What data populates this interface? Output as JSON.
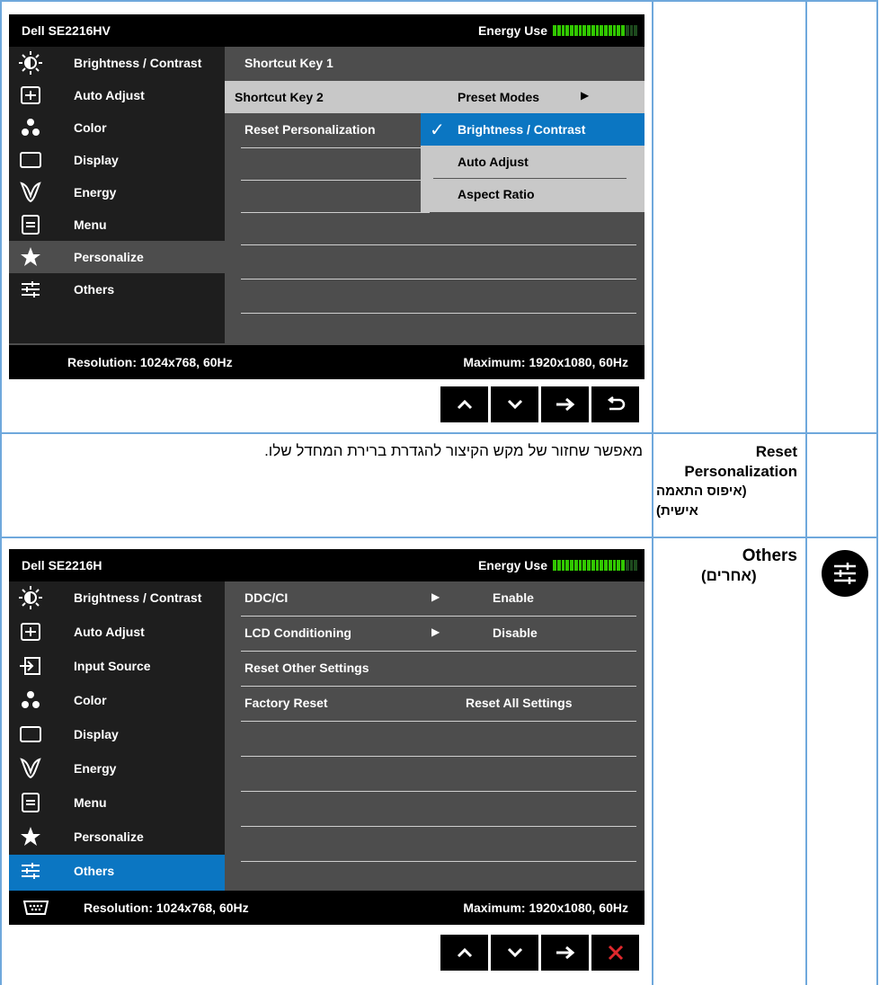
{
  "osd1": {
    "title": "Dell SE2216HV",
    "energy_label": "Energy Use",
    "energy_level": 0.85,
    "menu": [
      {
        "label": "Brightness / Contrast",
        "icon": "brightness-icon"
      },
      {
        "label": "Auto Adjust",
        "icon": "auto-adjust-icon"
      },
      {
        "label": "Color",
        "icon": "color-icon"
      },
      {
        "label": "Display",
        "icon": "display-icon"
      },
      {
        "label": "Energy",
        "icon": "energy-icon"
      },
      {
        "label": "Menu",
        "icon": "menu-icon"
      },
      {
        "label": "Personalize",
        "icon": "star-icon"
      },
      {
        "label": "Others",
        "icon": "others-icon"
      }
    ],
    "rows": [
      "Shortcut Key 1",
      "Shortcut Key 2",
      "Reset Personalization"
    ],
    "dropdown": [
      "Preset Modes",
      "Brightness / Contrast",
      "Auto Adjust",
      "Aspect Ratio"
    ],
    "resolution": "Resolution: 1024x768, 60Hz",
    "maximum": "Maximum: 1920x1080, 60Hz"
  },
  "reset_desc": "מאפשר שחזור של מקש הקיצור להגדרת ברירת המחדל שלו.",
  "reset_label": {
    "line1": "Reset",
    "line2": "Personalization",
    "line3": "(איפוס התאמה",
    "line4": "אישית)"
  },
  "others_label": {
    "line1": "Others",
    "line2": "(אחרים)"
  },
  "osd2": {
    "title": "Dell SE2216H",
    "energy_label": "Energy Use",
    "energy_level": 0.85,
    "menu": [
      {
        "label": "Brightness / Contrast",
        "icon": "brightness-icon"
      },
      {
        "label": "Auto Adjust",
        "icon": "auto-adjust-icon"
      },
      {
        "label": "Input Source",
        "icon": "input-source-icon"
      },
      {
        "label": "Color",
        "icon": "color-icon"
      },
      {
        "label": "Display",
        "icon": "display-icon"
      },
      {
        "label": "Energy",
        "icon": "energy-icon"
      },
      {
        "label": "Menu",
        "icon": "menu-icon"
      },
      {
        "label": "Personalize",
        "icon": "star-icon"
      },
      {
        "label": "Others",
        "icon": "others-icon"
      }
    ],
    "rows": [
      {
        "label": "DDC/CI",
        "value": "Enable"
      },
      {
        "label": "LCD Conditioning",
        "value": "Disable"
      },
      {
        "label": "Reset Other Settings",
        "value": ""
      },
      {
        "label": "Factory Reset",
        "value": "Reset All Settings"
      }
    ],
    "resolution": "Resolution: 1024x768, 60Hz",
    "maximum": "Maximum: 1920x1080, 60Hz"
  }
}
